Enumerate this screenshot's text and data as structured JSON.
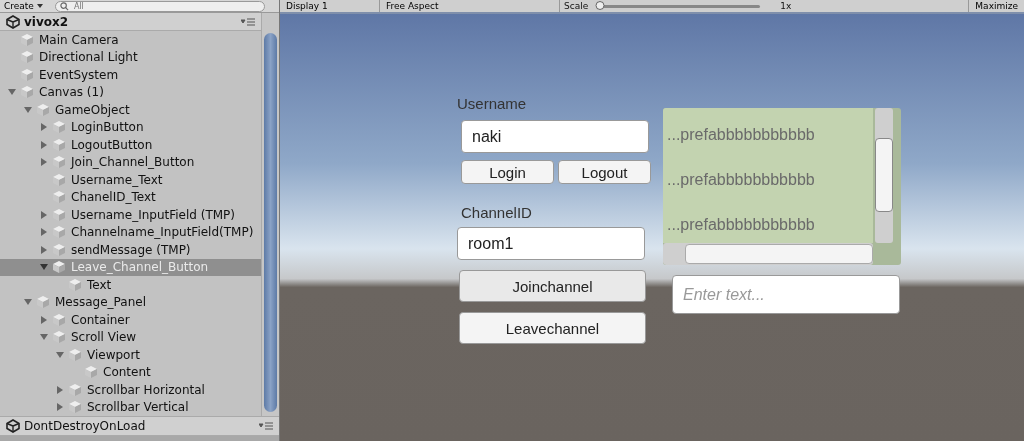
{
  "hierarchy": {
    "create_button": "Create",
    "search": {
      "placeholder": "All"
    },
    "scene": "vivox2",
    "items": [
      {
        "name": "Main Camera",
        "selected": false
      },
      {
        "name": "Directional Light",
        "selected": false
      },
      {
        "name": "EventSystem",
        "selected": false
      },
      {
        "name": "Canvas (1)",
        "expanded": true,
        "selected": false,
        "children": [
          {
            "name": "GameObject",
            "expanded": true,
            "selected": false,
            "children": [
              {
                "name": "LoginButton",
                "expanded": false,
                "selected": false
              },
              {
                "name": "LogoutButton",
                "expanded": false,
                "selected": false
              },
              {
                "name": "Join_Channel_Button",
                "expanded": false,
                "selected": false
              },
              {
                "name": "Username_Text",
                "selected": false
              },
              {
                "name": "ChanelID_Text",
                "selected": false
              },
              {
                "name": "Username_InputField (TMP)",
                "expanded": false,
                "selected": false
              },
              {
                "name": "Channelname_InputField(TMP)",
                "expanded": false,
                "selected": false
              },
              {
                "name": "sendMessage (TMP)",
                "expanded": false,
                "selected": false
              },
              {
                "name": "Leave_Channel_Button",
                "expanded": true,
                "selected": true,
                "children": [
                  {
                    "name": "Text",
                    "selected": false
                  }
                ]
              }
            ]
          },
          {
            "name": "Message_Panel",
            "expanded": true,
            "selected": false,
            "children": [
              {
                "name": "Container",
                "expanded": false,
                "selected": false
              },
              {
                "name": "Scroll View",
                "expanded": true,
                "selected": false,
                "children": [
                  {
                    "name": "Viewport",
                    "expanded": true,
                    "selected": false,
                    "children": [
                      {
                        "name": "Content",
                        "selected": false
                      }
                    ]
                  },
                  {
                    "name": "Scrollbar Horizontal",
                    "expanded": false,
                    "selected": false
                  },
                  {
                    "name": "Scrollbar Vertical",
                    "expanded": false,
                    "selected": false
                  }
                ]
              }
            ]
          }
        ]
      }
    ],
    "footer_scene": "DontDestroyOnLoad"
  },
  "game_toolbar": {
    "display": "Display 1",
    "aspect": "Free Aspect",
    "scale_label": "Scale",
    "scale": {
      "level": 0
    },
    "scale_value": "1x",
    "maximize": "Maximize"
  },
  "game": {
    "username_label": "Username",
    "username_value": "naki",
    "login": "Login",
    "logout": "Logout",
    "channel_label": "ChannelID",
    "channel_value": "room1",
    "join": "Joinchannel",
    "leave": "Leavechannel",
    "messages": [
      "...prefabbbbbbbbbbb",
      "...prefabbbbbbbbbbb",
      "...prefabbbbbbbbbbb"
    ],
    "message_input": {
      "placeholder": "Enter text..."
    }
  }
}
